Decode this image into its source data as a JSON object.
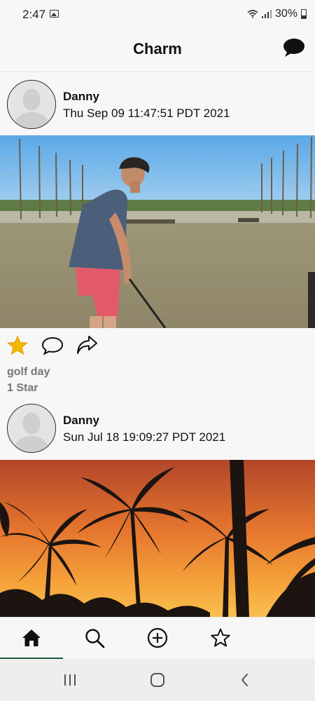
{
  "status_bar": {
    "time": "2:47",
    "battery": "30%",
    "icons": [
      "gallery-icon",
      "wifi-icon",
      "signal-icon",
      "battery-icon"
    ]
  },
  "header": {
    "title": "Charm",
    "right_icon": "chat-bubble-icon"
  },
  "posts": [
    {
      "user": "Danny",
      "date": "Thu Sep 09 11:47:51 PDT 2021",
      "image": "golf-range-photo",
      "caption": "golf day",
      "stars": "1 Star",
      "starred": true
    },
    {
      "user": "Danny",
      "date": "Sun Jul 18 19:09:27 PDT 2021",
      "image": "palm-trees-sunset-photo"
    }
  ],
  "actions": {
    "icons": [
      "star-icon",
      "comment-icon",
      "share-icon"
    ]
  },
  "tabs": {
    "items": [
      "home-icon",
      "search-icon",
      "add-post-icon",
      "favorites-star-icon"
    ],
    "active_index": 0
  },
  "colors": {
    "star": "#f5b800",
    "active_tab": "#1b5e3a"
  }
}
